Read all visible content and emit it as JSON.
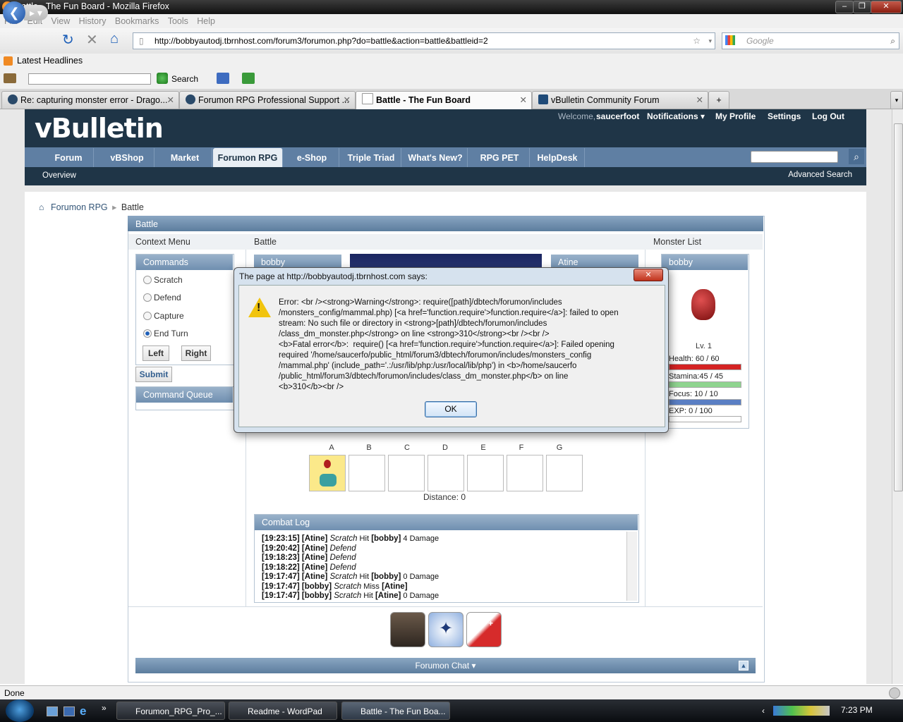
{
  "window": {
    "title": "Battle - The Fun Board - Mozilla Firefox"
  },
  "menu": [
    "File",
    "Edit",
    "View",
    "History",
    "Bookmarks",
    "Tools",
    "Help"
  ],
  "address": {
    "url": "http://bobbyautodj.tbrnhost.com/forum3/forumon.php?do=battle&action=battle&battleid=2",
    "search_placeholder": "Google"
  },
  "bookmarks": {
    "latest": "Latest Headlines"
  },
  "toolbar2": {
    "search_label": "Search"
  },
  "tabs": [
    {
      "label": "Re: capturing monster error - Drago..."
    },
    {
      "label": "Forumon RPG Professional Support ..."
    },
    {
      "label": "Battle - The Fun Board"
    },
    {
      "label": "vBulletin Community Forum"
    }
  ],
  "vb": {
    "logo": "vBulletin",
    "welcome": "Welcome,",
    "username": "saucerfoot",
    "notifications": "Notifications ▾",
    "my_profile": "My Profile",
    "settings": "Settings",
    "logout": "Log Out",
    "nav": [
      "Forum",
      "vBShop",
      "Market",
      "Forumon RPG",
      "e-Shop",
      "Triple Triad",
      "What's New?",
      "RPG PET",
      "HelpDesk"
    ],
    "subnav_overview": "Overview",
    "advanced_search": "Advanced Search"
  },
  "breadcrumb": {
    "root": "Forumon RPG",
    "current": "Battle"
  },
  "battle": {
    "header": "Battle",
    "col_context": "Context Menu",
    "col_battle": "Battle",
    "col_monsters": "Monster List",
    "commands_title": "Commands",
    "commands": [
      "Scratch",
      "Defend",
      "Capture",
      "End Turn"
    ],
    "left": "Left",
    "right": "Right",
    "submit": "Submit",
    "queue_title": "Command Queue",
    "player_name": "bobby",
    "enemy_name": "Atine",
    "grid_labels": [
      "A",
      "B",
      "C",
      "D",
      "E",
      "F",
      "G"
    ],
    "distance": "Distance: 0",
    "combat_log_title": "Combat Log",
    "log": [
      {
        "time": "[19:23:15]",
        "actor": "[Atine]",
        "move": "Scratch",
        "result": "Hit",
        "target": "[bobby]",
        "dmg": "4 Damage"
      },
      {
        "time": "[19:20:42]",
        "actor": "[Atine]",
        "move": "Defend",
        "result": "",
        "target": "",
        "dmg": ""
      },
      {
        "time": "[19:18:23]",
        "actor": "[Atine]",
        "move": "Defend",
        "result": "",
        "target": "",
        "dmg": ""
      },
      {
        "time": "[19:18:22]",
        "actor": "[Atine]",
        "move": "Defend",
        "result": "",
        "target": "",
        "dmg": ""
      },
      {
        "time": "[19:17:47]",
        "actor": "[Atine]",
        "move": "Scratch",
        "result": "Hit",
        "target": "[bobby]",
        "dmg": "0 Damage"
      },
      {
        "time": "[19:17:47]",
        "actor": "[bobby]",
        "move": "Scratch",
        "result": "Miss",
        "target": "[Atine]",
        "dmg": ""
      },
      {
        "time": "[19:17:47]",
        "actor": "[bobby]",
        "move": "Scratch",
        "result": "Hit",
        "target": "[Atine]",
        "dmg": "0 Damage"
      }
    ],
    "monster": {
      "name": "bobby",
      "level": "Lv. 1",
      "health": "Health:  60 / 60",
      "stamina": "Stamina:45 / 45",
      "focus": "Focus:   10 / 10",
      "exp": "EXP:     0 / 100",
      "health_frac": 1.0,
      "stamina_frac": 1.0,
      "focus_frac": 1.0,
      "exp_frac": 0.0
    },
    "chat_title": "Forumon Chat ▾"
  },
  "dialog": {
    "title": "The page at http://bobbyautodj.tbrnhost.com says:",
    "message": "Error: <br /><strong>Warning</strong>: require([path]/dbtech/forumon/includes\n/monsters_config/mammal.php) [<a href='function.require'>function.require</a>]: failed to open\nstream: No such file or directory in <strong>[path]/dbtech/forumon/includes\n/class_dm_monster.php</strong> on line <strong>310</strong><br /><br />\n<b>Fatal error</b>:  require() [<a href='function.require'>function.require</a>]: Failed opening\nrequired '/home/saucerfo/public_html/forum3/dbtech/forumon/includes/monsters_config\n/mammal.php' (include_path='.:/usr/lib/php:/usr/local/lib/php') in <b>/home/saucerfo\n/public_html/forum3/dbtech/forumon/includes/class_dm_monster.php</b> on line\n<b>310</b><br />",
    "ok": "OK"
  },
  "status": {
    "text": "Done"
  },
  "taskbar": {
    "items": [
      "Forumon_RPG_Pro_...",
      "Readme - WordPad",
      "Battle - The Fun Boa..."
    ],
    "clock": "7:23 PM"
  },
  "colors": {
    "header": "#1f3547",
    "nav": "#5f7fa3",
    "health": "#d42323",
    "stamina": "#8fd48f",
    "focus": "#5a7fc4"
  }
}
